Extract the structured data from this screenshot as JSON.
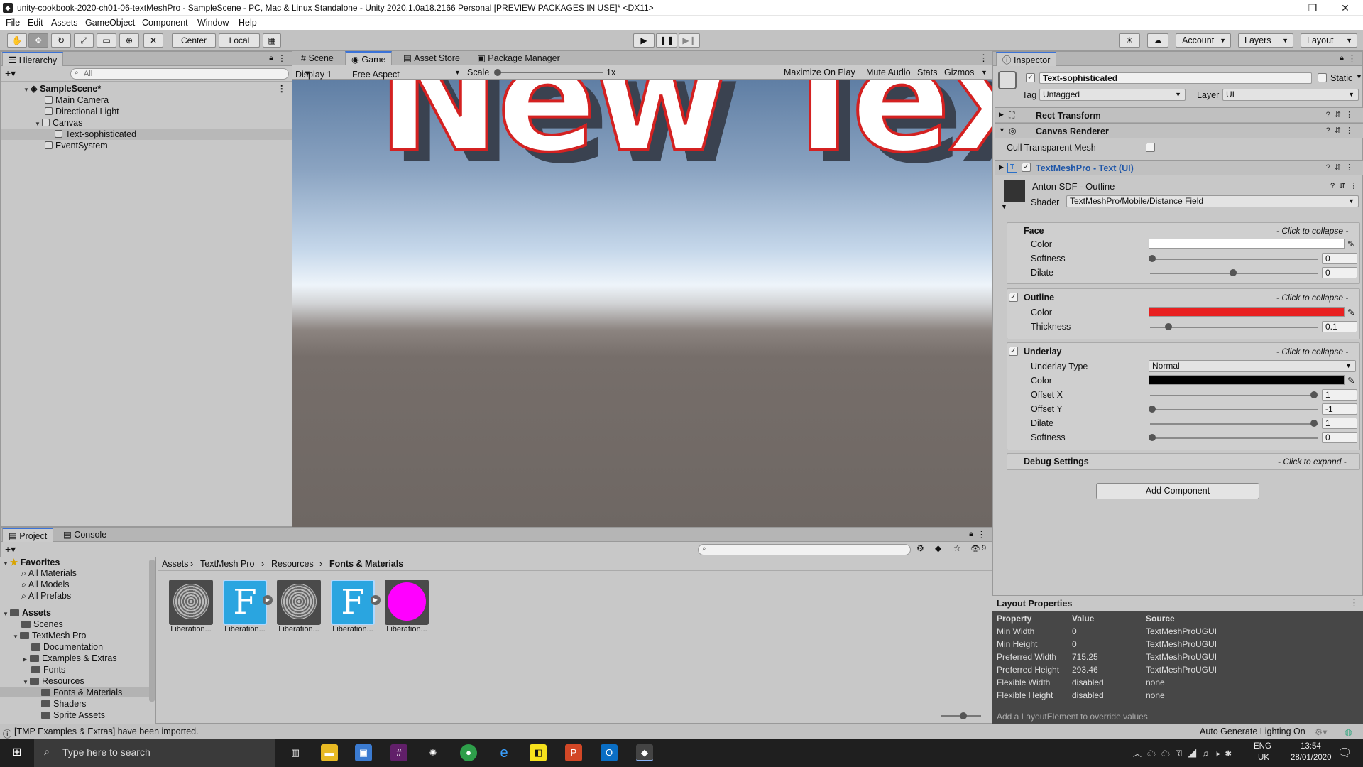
{
  "window": {
    "title": "unity-cookbook-2020-ch01-06-textMeshPro - SampleScene - PC, Mac & Linux Standalone - Unity 2020.1.0a18.2166 Personal [PREVIEW PACKAGES IN USE]* <DX11>"
  },
  "menu": [
    "File",
    "Edit",
    "Assets",
    "GameObject",
    "Component",
    "Window",
    "Help"
  ],
  "toolbar": {
    "pivot_center": "Center",
    "pivot_local": "Local",
    "account": "Account",
    "layers": "Layers",
    "layout": "Layout"
  },
  "hierarchy": {
    "tab": "Hierarchy",
    "search_placeholder": "All",
    "scene": "SampleScene*",
    "items": [
      "Main Camera",
      "Directional Light",
      "Canvas",
      "Text-sophisticated",
      "EventSystem"
    ]
  },
  "center_tabs": [
    "Scene",
    "Game",
    "Asset Store",
    "Package Manager"
  ],
  "game_toolbar": {
    "display": "Display 1",
    "aspect": "Free Aspect",
    "scale_label": "Scale",
    "scale_value": "1x",
    "maximize": "Maximize On Play",
    "mute": "Mute Audio",
    "stats": "Stats",
    "gizmos": "Gizmos"
  },
  "game_view": {
    "text": "New Text"
  },
  "inspector": {
    "tab": "Inspector",
    "object_name": "Text-sophisticated",
    "static_label": "Static",
    "tag_label": "Tag",
    "tag_value": "Untagged",
    "layer_label": "Layer",
    "layer_value": "UI",
    "components": {
      "rect_transform": "Rect Transform",
      "canvas_renderer": "Canvas Renderer",
      "cull_label": "Cull Transparent Mesh",
      "tmp": "TextMeshPro - Text (UI)"
    },
    "material": {
      "name": "Anton SDF - Outline",
      "shader_label": "Shader",
      "shader_value": "TextMeshPro/Mobile/Distance Field"
    },
    "face": {
      "title": "Face",
      "collapse": "- Click to collapse -",
      "color_label": "Color",
      "softness_label": "Softness",
      "softness_value": "0",
      "dilate_label": "Dilate",
      "dilate_value": "0",
      "color": "#ffffff"
    },
    "outline": {
      "title": "Outline",
      "collapse": "- Click to collapse -",
      "color_label": "Color",
      "thickness_label": "Thickness",
      "thickness_value": "0.1",
      "color": "#e82020"
    },
    "underlay": {
      "title": "Underlay",
      "collapse": "- Click to collapse -",
      "type_label": "Underlay Type",
      "type_value": "Normal",
      "color_label": "Color",
      "offset_x_label": "Offset X",
      "offset_x_value": "1",
      "offset_y_label": "Offset Y",
      "offset_y_value": "-1",
      "dilate_label": "Dilate",
      "dilate_value": "1",
      "softness_label": "Softness",
      "softness_value": "0",
      "color": "#000000"
    },
    "debug": {
      "title": "Debug Settings",
      "expand": "- Click to expand -"
    },
    "add_component": "Add Component"
  },
  "layout_properties": {
    "title": "Layout Properties",
    "headers": [
      "Property",
      "Value",
      "Source"
    ],
    "rows": [
      [
        "Min Width",
        "0",
        "TextMeshProUGUI"
      ],
      [
        "Min Height",
        "0",
        "TextMeshProUGUI"
      ],
      [
        "Preferred Width",
        "715.25",
        "TextMeshProUGUI"
      ],
      [
        "Preferred Height",
        "293.46",
        "TextMeshProUGUI"
      ],
      [
        "Flexible Width",
        "disabled",
        "none"
      ],
      [
        "Flexible Height",
        "disabled",
        "none"
      ]
    ],
    "hint": "Add a LayoutElement to override values"
  },
  "project": {
    "tabs": [
      "Project",
      "Console"
    ],
    "hidden_count": "9",
    "favorites": "Favorites",
    "fav_items": [
      "All Materials",
      "All Models",
      "All Prefabs"
    ],
    "assets": "Assets",
    "tree": [
      "Scenes",
      "TextMesh Pro",
      "Documentation",
      "Examples & Extras",
      "Fonts",
      "Resources",
      "Fonts & Materials",
      "Shaders",
      "Sprite Assets"
    ],
    "breadcrumb": [
      "Assets",
      "TextMesh Pro",
      "Resources",
      "Fonts & Materials"
    ],
    "asset_items": [
      "Liberation...",
      "Liberation...",
      "Liberation...",
      "Liberation...",
      "Liberation..."
    ]
  },
  "status": {
    "message": "[TMP Examples & Extras] have been imported.",
    "right": "Auto Generate Lighting On"
  },
  "taskbar": {
    "search_placeholder": "Type here to search",
    "lang": "ENG",
    "region": "UK",
    "time": "13:54",
    "date": "28/01/2020"
  }
}
